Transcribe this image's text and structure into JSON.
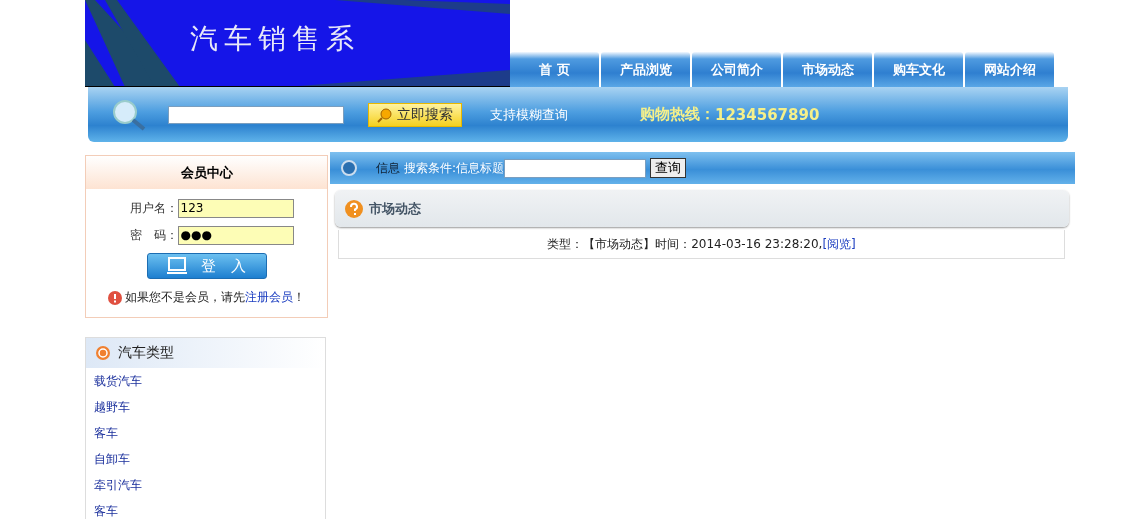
{
  "banner": {
    "title": "汽车销售系"
  },
  "nav": {
    "tabs": [
      {
        "label": "首 页"
      },
      {
        "label": "产品浏览"
      },
      {
        "label": "公司简介"
      },
      {
        "label": "市场动态"
      },
      {
        "label": "购车文化"
      },
      {
        "label": "网站介绍"
      }
    ]
  },
  "search_bar": {
    "button": "立即搜索",
    "hint": "支持模糊查询",
    "hotline_label": "购物热线：",
    "hotline_number": "1234567890"
  },
  "member_center": {
    "title": "会员中心",
    "username_label": "用户名：",
    "username_value": "123",
    "password_label": "密　码：",
    "password_value": "●●●",
    "login_button": "登　入",
    "notice": "如果您不是会员，请先",
    "register_link": "注册会员",
    "notice_end": "！"
  },
  "car_types": {
    "title": "汽车类型",
    "items": [
      "载货汽车",
      "越野车",
      "客车",
      "自卸车",
      "牵引汽车",
      "客车"
    ]
  },
  "info_search": {
    "label": "信息",
    "condition": "搜索条件:信息标题",
    "button": "查询"
  },
  "news_panel": {
    "title": "市场动态",
    "entries": [
      {
        "text": "类型：【市场动态】时间：2014-03-16 23:28:20,",
        "link": "[阅览]"
      }
    ]
  }
}
